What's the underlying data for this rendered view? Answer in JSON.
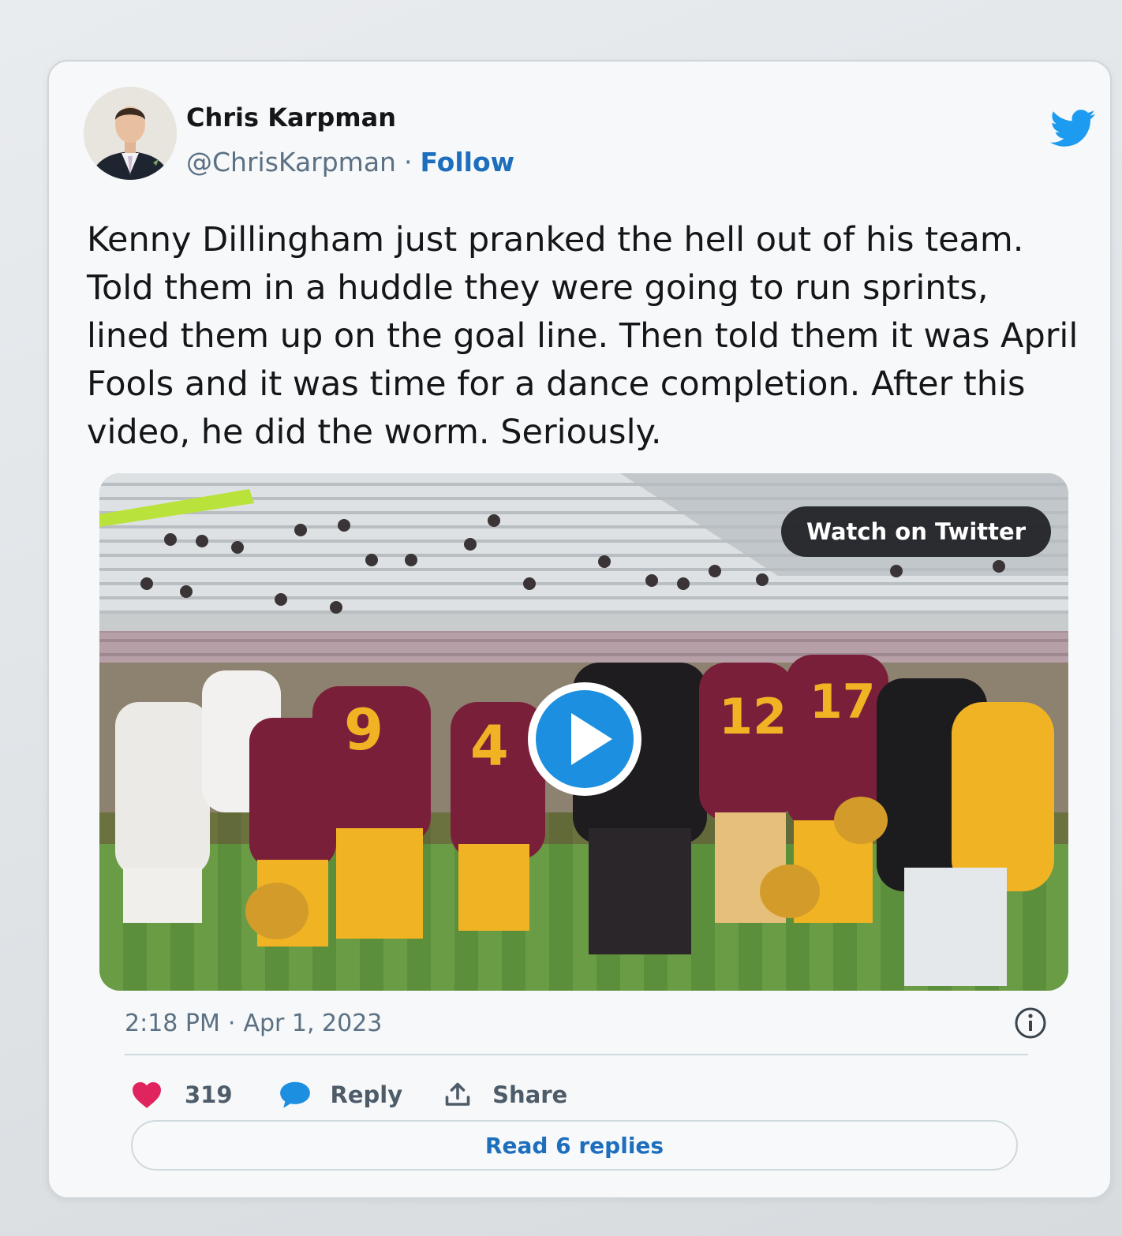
{
  "author": {
    "name": "Chris Karpman",
    "handle": "@ChrisKarpman",
    "separator": "·",
    "follow_label": "Follow"
  },
  "tweet": {
    "text": "Kenny Dillingham just pranked the hell out of his team.\nTold them in a huddle they were going to run sprints,\nlined them up on the goal line. Then told them it was April\nFools and it was time for a dance completion. After this\nvideo, he did the worm. Seriously."
  },
  "media": {
    "watch_label": "Watch on Twitter",
    "jersey_numbers": [
      "9",
      "4",
      "12",
      "17"
    ]
  },
  "meta": {
    "time": "2:18 PM",
    "separator": "·",
    "date": "Apr 1, 2023"
  },
  "actions": {
    "like_count": "319",
    "reply_label": "Reply",
    "share_label": "Share",
    "read_replies_label": "Read 6 replies"
  },
  "colors": {
    "brand_blue": "#1d9bf0",
    "like_red": "#e0245e",
    "link_blue": "#1d6ebd",
    "maroon": "#7a1f3a",
    "gold": "#f0b323"
  },
  "icons": [
    "twitter-bird-icon",
    "play-icon",
    "info-icon",
    "heart-icon",
    "reply-bubble-icon",
    "share-icon"
  ]
}
